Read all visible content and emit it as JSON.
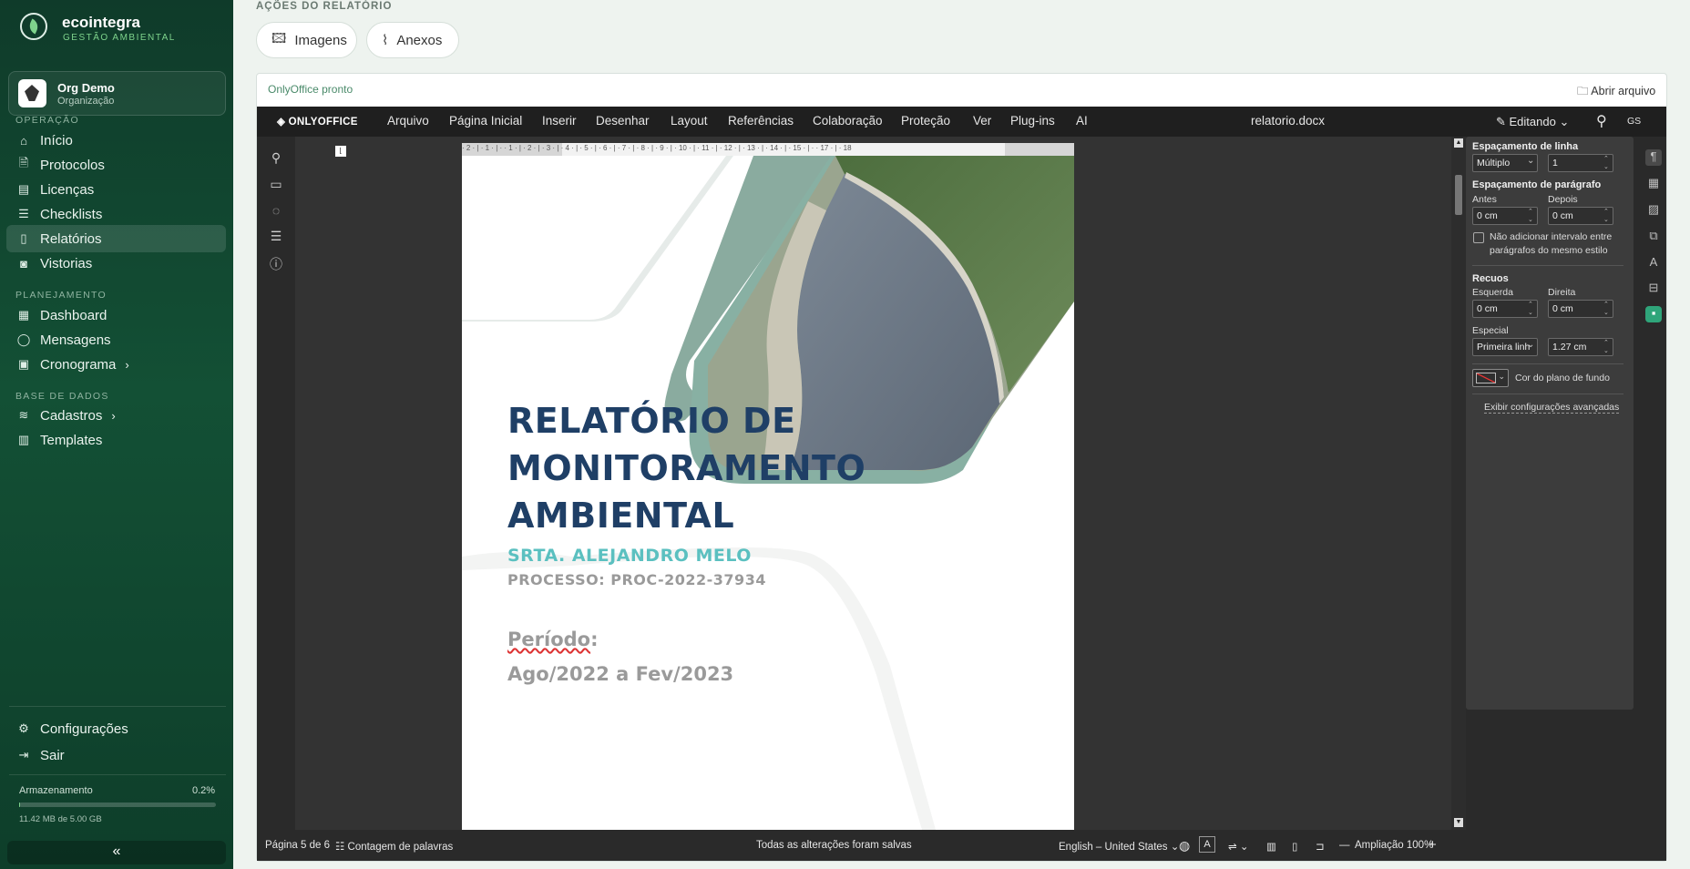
{
  "sidebar": {
    "brand": {
      "name": "ecointegra",
      "tagline": "GESTÃO AMBIENTAL"
    },
    "org": {
      "name": "Org Demo",
      "role": "Organização"
    },
    "sections": [
      {
        "title": "OPERAÇÃO",
        "items": [
          {
            "label": "Início",
            "icon": "home-icon"
          },
          {
            "label": "Protocolos",
            "icon": "document-icon"
          },
          {
            "label": "Licenças",
            "icon": "license-icon"
          },
          {
            "label": "Checklists",
            "icon": "checklist-icon"
          },
          {
            "label": "Relatórios",
            "icon": "report-icon",
            "active": true
          },
          {
            "label": "Vistorias",
            "icon": "camera-icon"
          }
        ]
      },
      {
        "title": "PLANEJAMENTO",
        "items": [
          {
            "label": "Dashboard",
            "icon": "dashboard-icon"
          },
          {
            "label": "Mensagens",
            "icon": "message-icon"
          },
          {
            "label": "Cronograma",
            "icon": "calendar-icon",
            "expandable": true
          }
        ]
      },
      {
        "title": "BASE DE DADOS",
        "items": [
          {
            "label": "Cadastros",
            "icon": "database-icon",
            "expandable": true
          },
          {
            "label": "Templates",
            "icon": "template-icon"
          }
        ]
      }
    ],
    "footer": {
      "settings": "Configurações",
      "logout": "Sair"
    },
    "storage": {
      "label": "Armazenamento",
      "percent_text": "0.2%",
      "percent": 0.2,
      "usage": "11.42 MB de 5.00 GB"
    },
    "collapse_glyph": "«"
  },
  "actions": {
    "title": "AÇÕES DO RELATÓRIO",
    "buttons": [
      {
        "label": "Imagens",
        "icon": "image-icon"
      },
      {
        "label": "Anexos",
        "icon": "paperclip-icon"
      }
    ]
  },
  "editor": {
    "status": "OnlyOffice pronto",
    "open_file": "Abrir arquivo",
    "logo": "ONLYOFFICE",
    "menu": [
      "Arquivo",
      "Página Inicial",
      "Inserir",
      "Desenhar",
      "Layout",
      "Referências",
      "Colaboração",
      "Proteção",
      "Ver",
      "Plug-ins",
      "AI"
    ],
    "filename": "relatorio.docx",
    "mode": "Editando",
    "user": "GS",
    "ruler": "· 2 · | · 1 · | ·   · 1 · | · 2 · | · 3 · | · 4 · | · 5 · | · 6 · | · 7 · | · 8 · | · 9 · | · 10 · | · 11 · | · 12 · | · 13 · | · 14 · | · 15 · | ·   · 17 · | · 18",
    "document": {
      "title_lines": [
        "RELATÓRIO DE",
        "MONITORAMENTO",
        "AMBIENTAL"
      ],
      "author": "SRTA. ALEJANDRO MELO",
      "process": "PROCESSO: PROC-2022-37934",
      "period_label": "Período",
      "period_colon": ":",
      "period_value": "Ago/2022 a Fev/2023"
    },
    "paragraph_panel": {
      "line_spacing_title": "Espaçamento de linha",
      "line_spacing_type": "Múltiplo",
      "line_spacing_value": "1",
      "paragraph_spacing_title": "Espaçamento de parágrafo",
      "before_label": "Antes",
      "before_value": "0 cm",
      "after_label": "Depois",
      "after_value": "0 cm",
      "no_interval_label": "Não adicionar intervalo entre parágrafos do mesmo estilo",
      "indents_title": "Recuos",
      "left_label": "Esquerda",
      "left_value": "0 cm",
      "right_label": "Direita",
      "right_value": "0 cm",
      "special_label": "Especial",
      "special_type": "Primeira linh",
      "special_value": "1.27 cm",
      "bg_color_label": "Cor do plano de fundo",
      "advanced_link": "Exibir configurações avançadas"
    },
    "statusbar": {
      "page": "Página 5 de 6",
      "word_count": "Contagem de palavras",
      "saved": "Todas as alterações foram salvas",
      "language": "English – United States",
      "zoom": "Ampliação 100%"
    }
  }
}
